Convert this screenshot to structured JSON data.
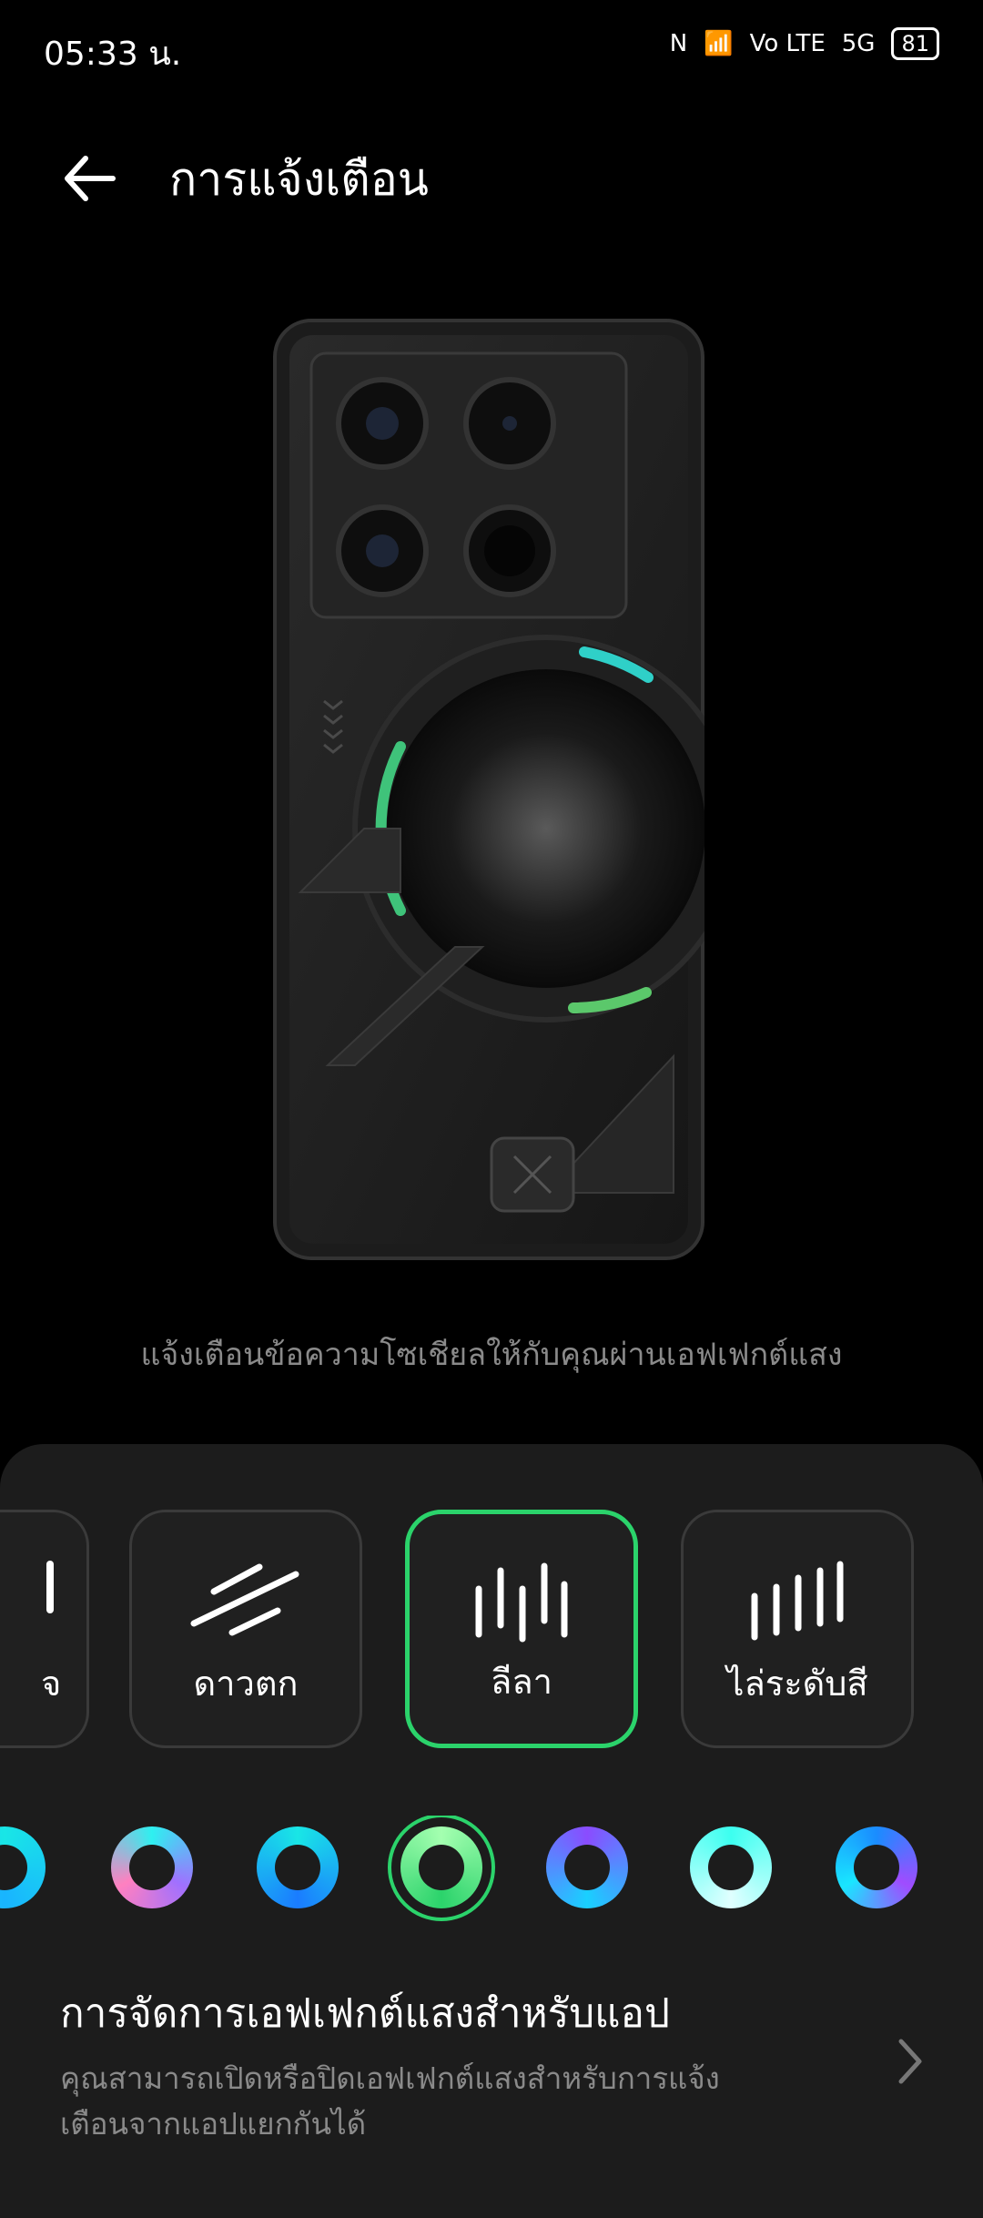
{
  "status_bar": {
    "time": "05:33 น.",
    "battery": "81",
    "network": "5G",
    "volte": "Vo LTE"
  },
  "header": {
    "title": "การแจ้งเตือน"
  },
  "description": "แจ้งเตือนข้อความโซเชียลให้กับคุณผ่านเอฟเฟกต์แสง",
  "effects": {
    "items": [
      {
        "label": "จ",
        "selected": false
      },
      {
        "label": "ดาวตก",
        "selected": false
      },
      {
        "label": "ลีลา",
        "selected": true
      },
      {
        "label": "ไล่ระดับสี",
        "selected": false
      }
    ]
  },
  "colors": {
    "options": [
      {
        "name": "cyan-partial",
        "selected": false
      },
      {
        "name": "cyan-pink",
        "selected": false
      },
      {
        "name": "cyan-blue",
        "selected": false
      },
      {
        "name": "green",
        "selected": true
      },
      {
        "name": "purple-cyan",
        "selected": false
      },
      {
        "name": "cyan-white",
        "selected": false
      },
      {
        "name": "blue-purple",
        "selected": false
      }
    ]
  },
  "app_effects": {
    "title": "การจัดการเอฟเฟกต์แสงสำหรับแอป",
    "subtitle": "คุณสามารถเปิดหรือปิดเอฟเฟกต์แสงสำหรับการแจ้งเตือนจากแอปแยกกันได้"
  }
}
